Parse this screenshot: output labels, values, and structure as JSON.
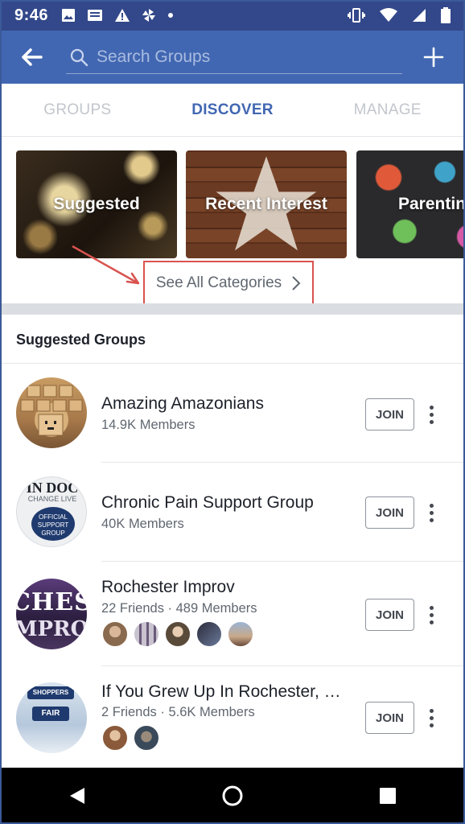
{
  "status_bar": {
    "time": "9:46"
  },
  "search": {
    "placeholder": "Search Groups"
  },
  "tabs": [
    {
      "label": "GROUPS",
      "active": false
    },
    {
      "label": "DISCOVER",
      "active": true
    },
    {
      "label": "MANAGE",
      "active": false
    }
  ],
  "categories": [
    {
      "label": "Suggested"
    },
    {
      "label": "Recent Interest"
    },
    {
      "label": "Parentin"
    }
  ],
  "see_all": {
    "label": "See All Categories"
  },
  "suggested_groups": {
    "title": "Suggested Groups",
    "join_label": "JOIN",
    "items": [
      {
        "name": "Amazing Amazonians",
        "meta": "14.9K Members"
      },
      {
        "name": "Chronic Pain Support Group",
        "meta": "40K Members",
        "avatar_text_top": "IN DOC",
        "avatar_text_sub": "CHANGE LIVE",
        "avatar_badge": "OFFICIAL SUPPORT GROUP"
      },
      {
        "name": "Rochester Improv",
        "meta": "22 Friends · 489 Members",
        "avatar_text_top": "CHES",
        "avatar_text_sub": "MPRO"
      },
      {
        "name": "If You Grew Up In Rochester, …",
        "meta": "2 Friends · 5.6K Members",
        "avatar_text_top": "SHOPPERS",
        "avatar_text_sub": "FAIR"
      }
    ]
  },
  "colors": {
    "brand": "#4267b2",
    "status_bar": "#33488a",
    "annotation": "#d9534f"
  }
}
